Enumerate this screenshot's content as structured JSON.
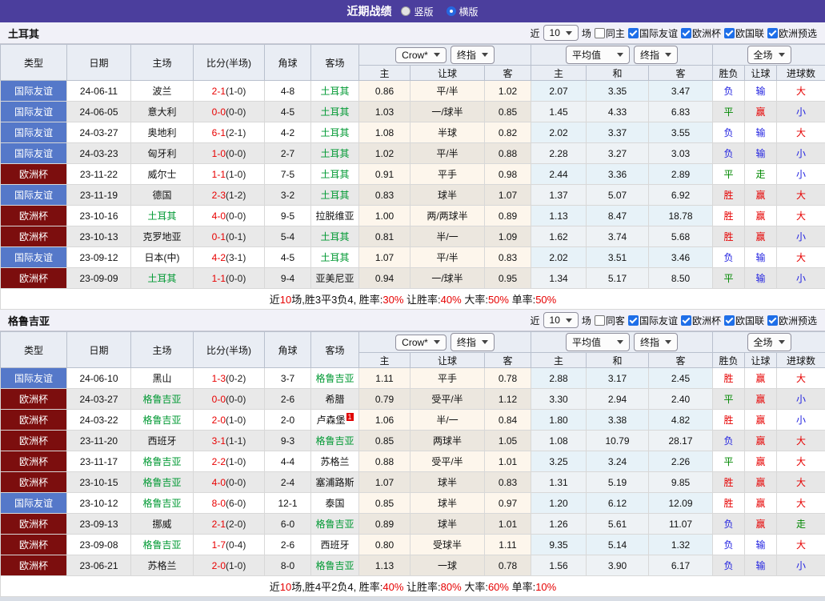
{
  "topbar": {
    "title": "近期战绩",
    "layout_options": [
      {
        "label": "竖版",
        "selected": false
      },
      {
        "label": "横版",
        "selected": true
      }
    ]
  },
  "filter": {
    "recent_label": "近",
    "recent_value": "10",
    "games_label": "场",
    "leagues": [
      "国际友谊",
      "欧洲杯",
      "欧国联",
      "欧洲预选"
    ]
  },
  "dropdowns": {
    "bookmaker": "Crow*",
    "final_odds": "终指",
    "average": "平均值",
    "full_match": "全场"
  },
  "table_columns": {
    "type": "类型",
    "date": "日期",
    "home": "主场",
    "score": "比分(半场)",
    "corners": "角球",
    "away": "客场",
    "odds_home": "主",
    "odds_handicap": "让球",
    "odds_away": "客",
    "avg_home": "主",
    "avg_draw": "和",
    "avg_away": "客",
    "result": "胜负",
    "handicap_result": "让球",
    "goals": "进球数"
  },
  "sections": [
    {
      "team": "土耳其",
      "same_venue_label": "同主",
      "rows": [
        {
          "league": "国际友谊",
          "league_type": "friendly",
          "date": "24-06-11",
          "home": "波兰",
          "home_hl": false,
          "score": "2-1",
          "half": "(1-0)",
          "corners": "4-8",
          "away": "土耳其",
          "away_hl": true,
          "away_sup": "",
          "odds": [
            "0.86",
            "平/半",
            "1.02"
          ],
          "avg": [
            "2.07",
            "3.35",
            "3.47"
          ],
          "outcome": [
            "负",
            "输",
            "大"
          ]
        },
        {
          "league": "国际友谊",
          "league_type": "friendly",
          "date": "24-06-05",
          "home": "意大利",
          "home_hl": false,
          "score": "0-0",
          "half": "(0-0)",
          "corners": "4-5",
          "away": "土耳其",
          "away_hl": true,
          "away_sup": "",
          "odds": [
            "1.03",
            "一/球半",
            "0.85"
          ],
          "avg": [
            "1.45",
            "4.33",
            "6.83"
          ],
          "outcome": [
            "平",
            "赢",
            "小"
          ]
        },
        {
          "league": "国际友谊",
          "league_type": "friendly",
          "date": "24-03-27",
          "home": "奥地利",
          "home_hl": false,
          "score": "6-1",
          "half": "(2-1)",
          "corners": "4-2",
          "away": "土耳其",
          "away_hl": true,
          "away_sup": "",
          "odds": [
            "1.08",
            "半球",
            "0.82"
          ],
          "avg": [
            "2.02",
            "3.37",
            "3.55"
          ],
          "outcome": [
            "负",
            "输",
            "大"
          ]
        },
        {
          "league": "国际友谊",
          "league_type": "friendly",
          "date": "24-03-23",
          "home": "匈牙利",
          "home_hl": false,
          "score": "1-0",
          "half": "(0-0)",
          "corners": "2-7",
          "away": "土耳其",
          "away_hl": true,
          "away_sup": "",
          "odds": [
            "1.02",
            "平/半",
            "0.88"
          ],
          "avg": [
            "2.28",
            "3.27",
            "3.03"
          ],
          "outcome": [
            "负",
            "输",
            "小"
          ]
        },
        {
          "league": "欧洲杯",
          "league_type": "eurocup",
          "date": "23-11-22",
          "home": "威尔士",
          "home_hl": false,
          "score": "1-1",
          "half": "(1-0)",
          "corners": "7-5",
          "away": "土耳其",
          "away_hl": true,
          "away_sup": "",
          "odds": [
            "0.91",
            "平手",
            "0.98"
          ],
          "avg": [
            "2.44",
            "3.36",
            "2.89"
          ],
          "outcome": [
            "平",
            "走",
            "小"
          ]
        },
        {
          "league": "国际友谊",
          "league_type": "friendly",
          "date": "23-11-19",
          "home": "德国",
          "home_hl": false,
          "score": "2-3",
          "half": "(1-2)",
          "corners": "3-2",
          "away": "土耳其",
          "away_hl": true,
          "away_sup": "",
          "odds": [
            "0.83",
            "球半",
            "1.07"
          ],
          "avg": [
            "1.37",
            "5.07",
            "6.92"
          ],
          "outcome": [
            "胜",
            "赢",
            "大"
          ]
        },
        {
          "league": "欧洲杯",
          "league_type": "eurocup",
          "date": "23-10-16",
          "home": "土耳其",
          "home_hl": true,
          "score": "4-0",
          "half": "(0-0)",
          "corners": "9-5",
          "away": "拉脱维亚",
          "away_hl": false,
          "away_sup": "",
          "odds": [
            "1.00",
            "两/两球半",
            "0.89"
          ],
          "avg": [
            "1.13",
            "8.47",
            "18.78"
          ],
          "outcome": [
            "胜",
            "赢",
            "大"
          ]
        },
        {
          "league": "欧洲杯",
          "league_type": "eurocup",
          "date": "23-10-13",
          "home": "克罗地亚",
          "home_hl": false,
          "score": "0-1",
          "half": "(0-1)",
          "corners": "5-4",
          "away": "土耳其",
          "away_hl": true,
          "away_sup": "",
          "odds": [
            "0.81",
            "半/一",
            "1.09"
          ],
          "avg": [
            "1.62",
            "3.74",
            "5.68"
          ],
          "outcome": [
            "胜",
            "赢",
            "小"
          ]
        },
        {
          "league": "国际友谊",
          "league_type": "friendly",
          "date": "23-09-12",
          "home": "日本(中)",
          "home_hl": false,
          "score": "4-2",
          "half": "(3-1)",
          "corners": "4-5",
          "away": "土耳其",
          "away_hl": true,
          "away_sup": "",
          "odds": [
            "1.07",
            "平/半",
            "0.83"
          ],
          "avg": [
            "2.02",
            "3.51",
            "3.46"
          ],
          "outcome": [
            "负",
            "输",
            "大"
          ]
        },
        {
          "league": "欧洲杯",
          "league_type": "eurocup",
          "date": "23-09-09",
          "home": "土耳其",
          "home_hl": true,
          "score": "1-1",
          "half": "(0-0)",
          "corners": "9-4",
          "away": "亚美尼亚",
          "away_hl": false,
          "away_sup": "",
          "odds": [
            "0.94",
            "一/球半",
            "0.95"
          ],
          "avg": [
            "1.34",
            "5.17",
            "8.50"
          ],
          "outcome": [
            "平",
            "输",
            "小"
          ]
        }
      ],
      "summary": {
        "recent_prefix": "近",
        "recent_games": "10",
        "record": "场,胜3平3负4,",
        "win_rate_label": "胜率:",
        "win_rate": "30%",
        "handicap_rate_label": "让胜率:",
        "handicap_rate": "40%",
        "big_rate_label": "大率:",
        "big_rate": "50%",
        "single_rate_label": "单率:",
        "single_rate": "50%"
      }
    },
    {
      "team": "格鲁吉亚",
      "same_venue_label": "同客",
      "rows": [
        {
          "league": "国际友谊",
          "league_type": "friendly",
          "date": "24-06-10",
          "home": "黑山",
          "home_hl": false,
          "score": "1-3",
          "half": "(0-2)",
          "corners": "3-7",
          "away": "格鲁吉亚",
          "away_hl": true,
          "away_sup": "",
          "odds": [
            "1.11",
            "平手",
            "0.78"
          ],
          "avg": [
            "2.88",
            "3.17",
            "2.45"
          ],
          "outcome": [
            "胜",
            "赢",
            "大"
          ]
        },
        {
          "league": "欧洲杯",
          "league_type": "eurocup",
          "date": "24-03-27",
          "home": "格鲁吉亚",
          "home_hl": true,
          "score": "0-0",
          "half": "(0-0)",
          "corners": "2-6",
          "away": "希腊",
          "away_hl": false,
          "away_sup": "",
          "odds": [
            "0.79",
            "受平/半",
            "1.12"
          ],
          "avg": [
            "3.30",
            "2.94",
            "2.40"
          ],
          "outcome": [
            "平",
            "赢",
            "小"
          ]
        },
        {
          "league": "欧洲杯",
          "league_type": "eurocup",
          "date": "24-03-22",
          "home": "格鲁吉亚",
          "home_hl": true,
          "score": "2-0",
          "half": "(1-0)",
          "corners": "2-0",
          "away": "卢森堡",
          "away_hl": false,
          "away_sup": "1",
          "odds": [
            "1.06",
            "半/一",
            "0.84"
          ],
          "avg": [
            "1.80",
            "3.38",
            "4.82"
          ],
          "outcome": [
            "胜",
            "赢",
            "小"
          ]
        },
        {
          "league": "欧洲杯",
          "league_type": "eurocup",
          "date": "23-11-20",
          "home": "西班牙",
          "home_hl": false,
          "score": "3-1",
          "half": "(1-1)",
          "corners": "9-3",
          "away": "格鲁吉亚",
          "away_hl": true,
          "away_sup": "",
          "odds": [
            "0.85",
            "两球半",
            "1.05"
          ],
          "avg": [
            "1.08",
            "10.79",
            "28.17"
          ],
          "outcome": [
            "负",
            "赢",
            "大"
          ]
        },
        {
          "league": "欧洲杯",
          "league_type": "eurocup",
          "date": "23-11-17",
          "home": "格鲁吉亚",
          "home_hl": true,
          "score": "2-2",
          "half": "(1-0)",
          "corners": "4-4",
          "away": "苏格兰",
          "away_hl": false,
          "away_sup": "",
          "odds": [
            "0.88",
            "受平/半",
            "1.01"
          ],
          "avg": [
            "3.25",
            "3.24",
            "2.26"
          ],
          "outcome": [
            "平",
            "赢",
            "大"
          ]
        },
        {
          "league": "欧洲杯",
          "league_type": "eurocup",
          "date": "23-10-15",
          "home": "格鲁吉亚",
          "home_hl": true,
          "score": "4-0",
          "half": "(0-0)",
          "corners": "2-4",
          "away": "塞浦路斯",
          "away_hl": false,
          "away_sup": "",
          "odds": [
            "1.07",
            "球半",
            "0.83"
          ],
          "avg": [
            "1.31",
            "5.19",
            "9.85"
          ],
          "outcome": [
            "胜",
            "赢",
            "大"
          ]
        },
        {
          "league": "国际友谊",
          "league_type": "friendly",
          "date": "23-10-12",
          "home": "格鲁吉亚",
          "home_hl": true,
          "score": "8-0",
          "half": "(6-0)",
          "corners": "12-1",
          "away": "泰国",
          "away_hl": false,
          "away_sup": "",
          "odds": [
            "0.85",
            "球半",
            "0.97"
          ],
          "avg": [
            "1.20",
            "6.12",
            "12.09"
          ],
          "outcome": [
            "胜",
            "赢",
            "大"
          ]
        },
        {
          "league": "欧洲杯",
          "league_type": "eurocup",
          "date": "23-09-13",
          "home": "挪威",
          "home_hl": false,
          "score": "2-1",
          "half": "(2-0)",
          "corners": "6-0",
          "away": "格鲁吉亚",
          "away_hl": true,
          "away_sup": "",
          "odds": [
            "0.89",
            "球半",
            "1.01"
          ],
          "avg": [
            "1.26",
            "5.61",
            "11.07"
          ],
          "outcome": [
            "负",
            "赢",
            "走"
          ]
        },
        {
          "league": "欧洲杯",
          "league_type": "eurocup",
          "date": "23-09-08",
          "home": "格鲁吉亚",
          "home_hl": true,
          "score": "1-7",
          "half": "(0-4)",
          "corners": "2-6",
          "away": "西班牙",
          "away_hl": false,
          "away_sup": "",
          "odds": [
            "0.80",
            "受球半",
            "1.11"
          ],
          "avg": [
            "9.35",
            "5.14",
            "1.32"
          ],
          "outcome": [
            "负",
            "输",
            "大"
          ]
        },
        {
          "league": "欧洲杯",
          "league_type": "eurocup",
          "date": "23-06-21",
          "home": "苏格兰",
          "home_hl": false,
          "score": "2-0",
          "half": "(1-0)",
          "corners": "8-0",
          "away": "格鲁吉亚",
          "away_hl": true,
          "away_sup": "",
          "odds": [
            "1.13",
            "一球",
            "0.78"
          ],
          "avg": [
            "1.56",
            "3.90",
            "6.17"
          ],
          "outcome": [
            "负",
            "输",
            "小"
          ]
        }
      ],
      "summary": {
        "recent_prefix": "近",
        "recent_games": "10",
        "record": "场,胜4平2负4,",
        "win_rate_label": "胜率:",
        "win_rate": "40%",
        "handicap_rate_label": "让胜率:",
        "handicap_rate": "80%",
        "big_rate_label": "大率:",
        "big_rate": "60%",
        "single_rate_label": "单率:",
        "single_rate": "10%"
      }
    }
  ]
}
